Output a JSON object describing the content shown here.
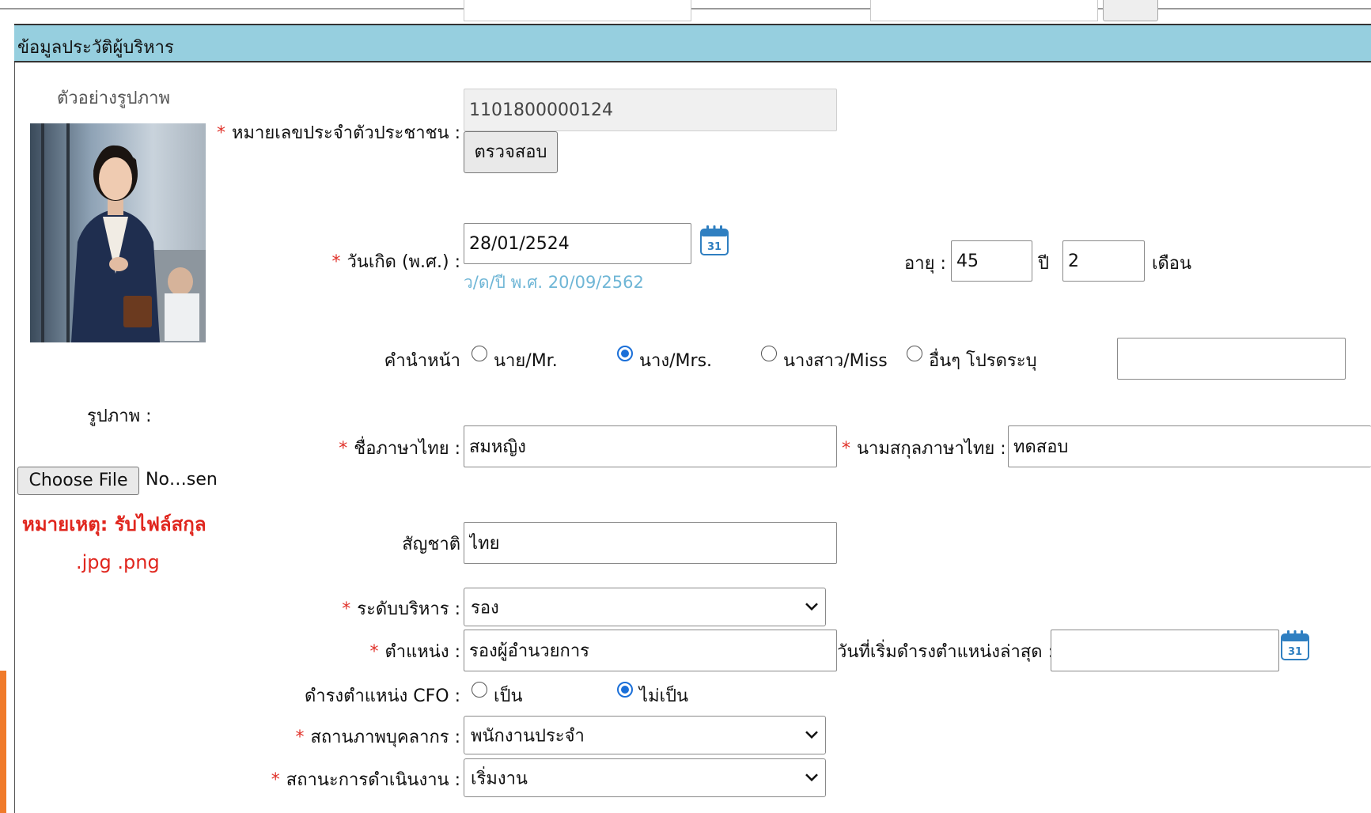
{
  "section": {
    "title": "ข้อมูลประวัติผู้บริหาร"
  },
  "photo": {
    "preview_label": "ตัวอย่างรูปภาพ",
    "field_label": "รูปภาพ :",
    "choose_file_label": "Choose File",
    "file_status": "No…sen",
    "note_line1": "หมายเหตุ: รับไฟล์สกุล",
    "note_line2": ".jpg .png"
  },
  "required_mark": "*",
  "citizen_id": {
    "label": "หมายเลขประจำตัวประชาชน :",
    "value": "1101800000124",
    "check_button": "ตรวจสอบ"
  },
  "birthdate": {
    "label": "วันเกิด (พ.ศ.) :",
    "value": "28/01/2524",
    "calendar_day": "31",
    "hint": "ว/ด/ปี พ.ศ. 20/09/2562",
    "age_label": "อายุ :",
    "age_years": "45",
    "years_unit": "ปี",
    "age_months": "2",
    "months_unit": "เดือน"
  },
  "prefix": {
    "label": "คำนำหน้า",
    "options": [
      "นาย/Mr.",
      "นาง/Mrs.",
      "นางสาว/Miss",
      "อื่นๆ โปรดระบุ"
    ],
    "selected": "นาง/Mrs.",
    "other_value": ""
  },
  "first_name_th": {
    "label": "ชื่อภาษาไทย :",
    "value": "สมหญิง"
  },
  "last_name_th": {
    "label": "นามสกุลภาษาไทย :",
    "value": "ทดสอบ"
  },
  "nationality": {
    "label": "สัญชาติ",
    "value": "ไทย"
  },
  "management_level": {
    "label": "ระดับบริหาร :",
    "value": "รอง"
  },
  "position": {
    "label": "ตำแหน่ง :",
    "value": "รองผู้อำนวยการ",
    "start_date_label": "วันที่เริ่มดำรงตำแหน่งล่าสุด :",
    "start_date_value": "",
    "calendar_day": "31"
  },
  "cfo": {
    "label": "ดำรงตำแหน่ง CFO :",
    "options": [
      "เป็น",
      "ไม่เป็น"
    ],
    "selected": "ไม่เป็น"
  },
  "personnel_status": {
    "label": "สถานภาพบุคลากร :",
    "value": "พนักงานประจำ"
  },
  "operation_status": {
    "label": "สถานะการดำเนินงาน :",
    "value": "เริ่มงาน"
  },
  "icons": {
    "calendar": "calendar-icon",
    "dropdown": "chevron-down-icon"
  },
  "colors": {
    "header_bg": "#96cfdf",
    "required": "#e0322a",
    "note": "#e0261e",
    "radio_selected": "#1a6fd8",
    "hint": "#6fb6d6"
  }
}
